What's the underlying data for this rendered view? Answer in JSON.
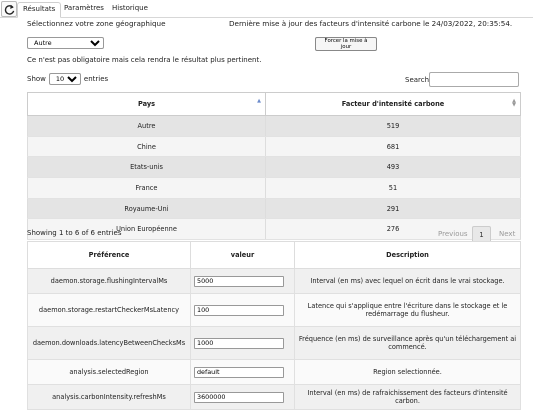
{
  "tabs": [
    "Résultats",
    "Paramètres",
    "Historique"
  ],
  "header": {
    "zone_label": "Sélectionnez votre zone géographique",
    "last_update": "Dernière mise à jour des facteurs d'intensité carbone le 24/03/2022, 20:35:54.",
    "zone_selected": "Autre",
    "force_update_label": "Forcer la mise à jour",
    "note": "Ce n'est pas obligatoire mais cela rendra le résultat plus pertinent."
  },
  "length": {
    "show_label": "Show",
    "value": "10",
    "entries_label": "entries",
    "search_label": "Search:"
  },
  "countries": {
    "columns": [
      "Pays",
      "Facteur d'intensité carbone"
    ],
    "rows": [
      [
        "Autre",
        "519"
      ],
      [
        "Chine",
        "681"
      ],
      [
        "Etats-unis",
        "493"
      ],
      [
        "France",
        "51"
      ],
      [
        "Royaume-Uni",
        "291"
      ],
      [
        "Union Européenne",
        "276"
      ]
    ],
    "info": "Showing 1 to 6 of 6 entries",
    "pager": {
      "previous": "Previous",
      "current": "1",
      "next": "Next"
    }
  },
  "preferences": {
    "columns": [
      "Préférence",
      "valeur",
      "Description"
    ],
    "rows": [
      {
        "name": "daemon.storage.flushingIntervalMs",
        "value": "5000",
        "desc": "Interval (en ms) avec lequel on écrit dans le vrai stockage."
      },
      {
        "name": "daemon.storage.restartCheckerMsLatency",
        "value": "100",
        "desc": "Latence qui s'applique entre l'écriture dans le stockage et le redémarrage du flusheur."
      },
      {
        "name": "daemon.downloads.latencyBetweenChecksMs",
        "value": "1000",
        "desc": "Fréquence (en ms) de surveillance après qu'un téléchargement ai commencé."
      },
      {
        "name": "analysis.selectedRegion",
        "value": "default",
        "desc": "Region selectionnée."
      },
      {
        "name": "analysis.carbonIntensity.refreshMs",
        "value": "3600000",
        "desc": "Interval (en ms) de rafraichissement des facteurs d'intensité carbon."
      }
    ]
  }
}
